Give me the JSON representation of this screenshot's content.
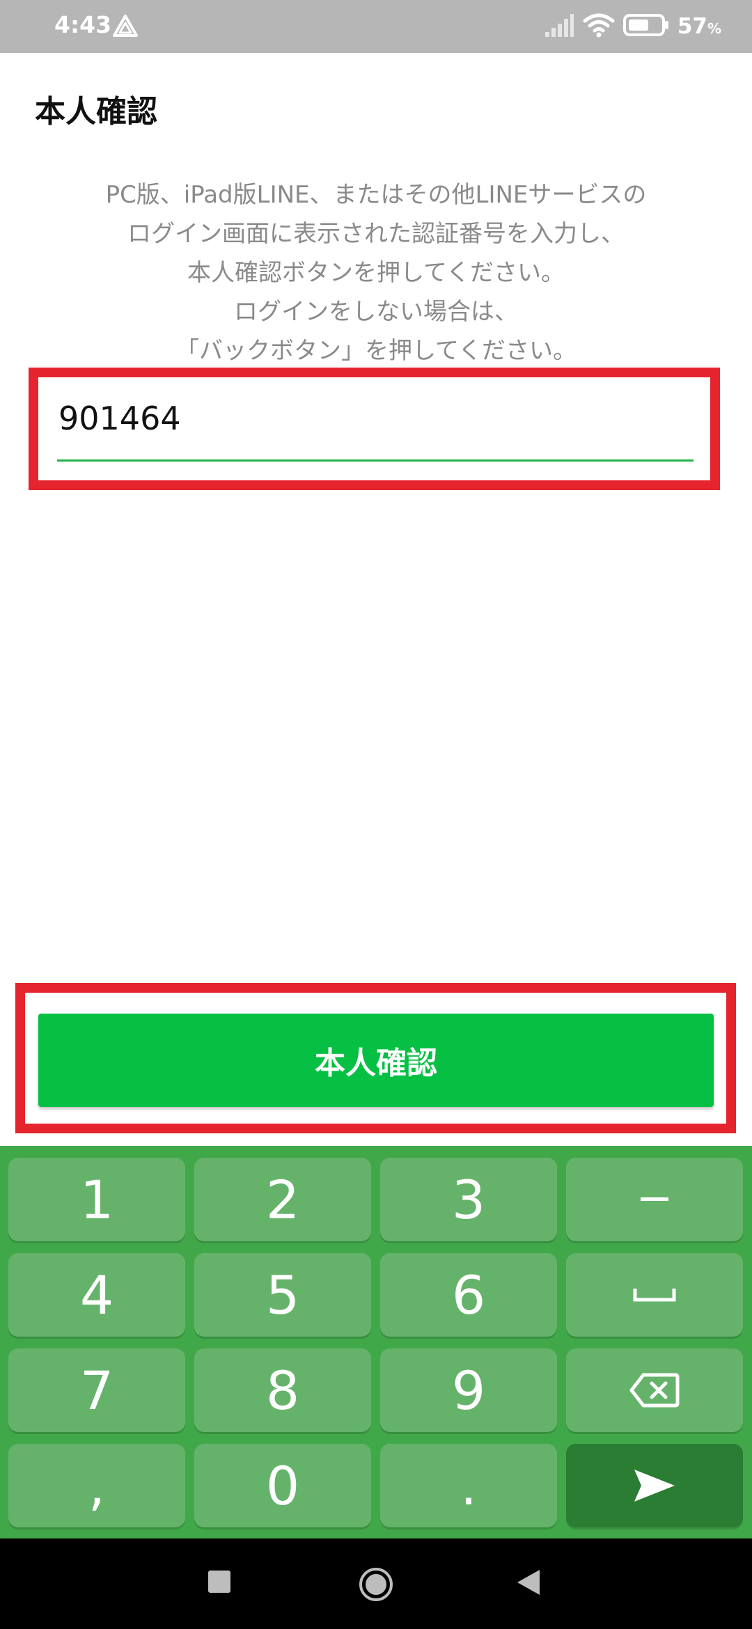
{
  "status_bar": {
    "time": "4:43",
    "battery_percent": "57",
    "battery_unit": "%",
    "icons": [
      "alert-triangle-icon",
      "signal-icon",
      "wifi-icon",
      "battery-icon"
    ]
  },
  "page": {
    "title": "本人確認",
    "instructions": [
      "PC版、iPad版LINE、またはその他LINEサービスの",
      "ログイン画面に表示された認証番号を入力し、",
      "本人確認ボタンを押してください。",
      "ログインをしない場合は、",
      "「バックボタン」を押してください。"
    ],
    "code_value": "901464",
    "confirm_label": "本人確認"
  },
  "keypad": {
    "keys": [
      "1",
      "2",
      "3",
      "−",
      "4",
      "5",
      "6",
      "␣",
      "7",
      "8",
      "9",
      "⌫",
      ",",
      "0",
      ".",
      "➤"
    ],
    "icons": [
      "minus-icon",
      "space-icon",
      "backspace-icon",
      "send-icon"
    ]
  },
  "nav_bar": {
    "icons": [
      "recents-square-icon",
      "home-circle-icon",
      "back-triangle-icon"
    ]
  },
  "colors": {
    "accent": "#06c043",
    "highlight": "#e5242d",
    "keypad_bg": "#41a84a",
    "key_bg": "#65b36b",
    "enter_key_bg": "#2a7d32",
    "status_bar_bg": "#b6b6b6"
  }
}
